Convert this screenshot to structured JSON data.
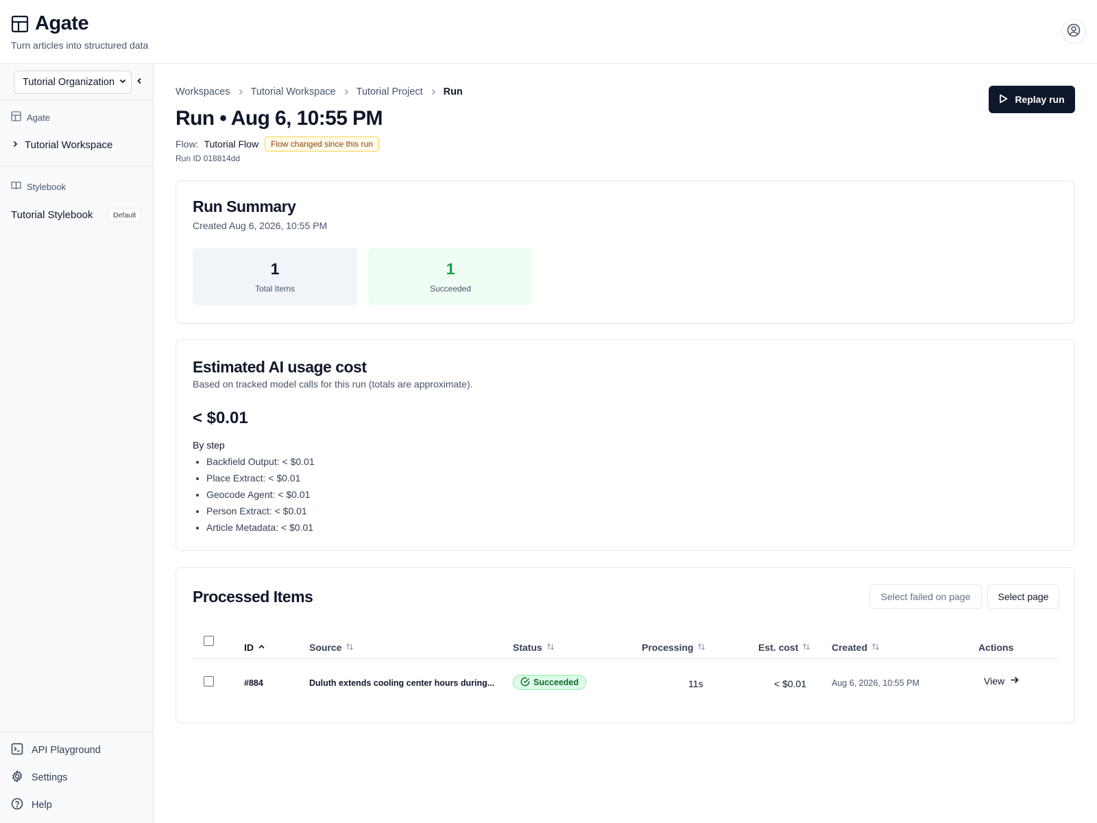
{
  "header": {
    "app_name": "Agate",
    "tagline": "Turn articles into structured data"
  },
  "sidebar": {
    "org_select": "Tutorial Organization",
    "section_agate": "Agate",
    "workspace_item": "Tutorial Workspace",
    "section_stylebook": "Stylebook",
    "stylebook_item": "Tutorial Stylebook",
    "stylebook_badge": "Default",
    "bottom_items": [
      "API Playground",
      "Settings",
      "Help"
    ]
  },
  "breadcrumb": [
    "Workspaces",
    "Tutorial Workspace",
    "Tutorial Project",
    "Run"
  ],
  "page": {
    "title": "Run • Aug 6, 10:55 PM",
    "flow_label": "Flow:",
    "flow_name": "Tutorial Flow",
    "flow_warning": "Flow changed since this run",
    "run_id": "Run ID 018814dd",
    "replay_label": "Replay run"
  },
  "summary": {
    "title": "Run Summary",
    "created": "Created Aug 6, 2026, 10:55 PM",
    "stats": [
      {
        "value": "1",
        "label": "Total Items",
        "color": "#0f172a"
      },
      {
        "value": "1",
        "label": "Succeeded",
        "color": "#16a34a"
      }
    ]
  },
  "cost": {
    "title": "Estimated AI usage cost",
    "subtitle": "Based on tracked model calls for this run (totals are approximate).",
    "total": "< $0.01",
    "by_step_label": "By step",
    "steps": [
      "Backfield Output: < $0.01",
      "Place Extract: < $0.01",
      "Geocode Agent: < $0.01",
      "Person Extract: < $0.01",
      "Article Metadata: < $0.01"
    ]
  },
  "items": {
    "title": "Processed Items",
    "select_failed_label": "Select failed on page",
    "select_page_label": "Select page",
    "columns": [
      "ID",
      "Source",
      "Status",
      "Processing",
      "Est. cost",
      "Created",
      "Actions"
    ],
    "rows": [
      {
        "id": "#884",
        "source": "Duluth extends cooling center hours during...",
        "status": "Succeeded",
        "processing": "11s",
        "cost": "< $0.01",
        "created": "Aug 6, 2026, 10:55 PM",
        "action": "View"
      }
    ]
  },
  "colors": {
    "primary": "#0f172a",
    "success": "#16a34a",
    "warning_bg": "#fffbeb"
  }
}
